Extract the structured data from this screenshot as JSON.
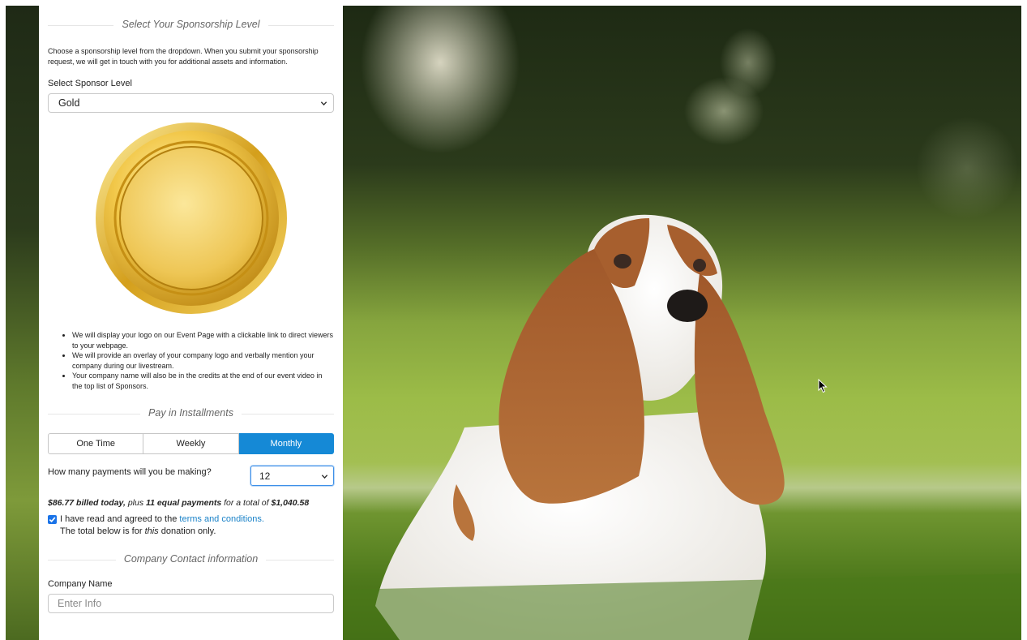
{
  "sponsorship": {
    "header": "Select Your Sponsorship Level",
    "intro": "Choose a sponsorship level from the dropdown. When you submit your sponsorship request, we will get in touch with you for additional assets and information.",
    "level_label": "Select Sponsor Level",
    "level_value": "Gold",
    "benefits": [
      "We will display your logo on our Event Page with a clickable link to direct viewers to your webpage.",
      "We will provide an overlay of your company logo and verbally mention your company during our livestream.",
      "Your company name will also be in the credits at the end of our event video in the top list of Sponsors."
    ]
  },
  "installments": {
    "header": "Pay in Installments",
    "tabs": [
      "One Time",
      "Weekly",
      "Monthly"
    ],
    "active_tab": "Monthly",
    "payments_label": "How many payments will you be making?",
    "payments_value": "12",
    "summary": {
      "today": "$86.77 billed today,",
      "plus": " plus ",
      "payments": "11 equal payments",
      "for_total": " for a total of ",
      "total": "$1,040.58"
    },
    "agree_prefix": "I have read and agreed to the ",
    "agree_link": "terms and conditions.",
    "total_note_prefix": "The total below is for ",
    "total_note_em": "this",
    "total_note_suffix": " donation only."
  },
  "contact": {
    "header": "Company Contact information",
    "company_name_label": "Company Name",
    "company_name_placeholder": "Enter Info"
  },
  "colors": {
    "accent": "#1589d6",
    "link": "#1a82c8",
    "gold": "#d9aa1e"
  }
}
